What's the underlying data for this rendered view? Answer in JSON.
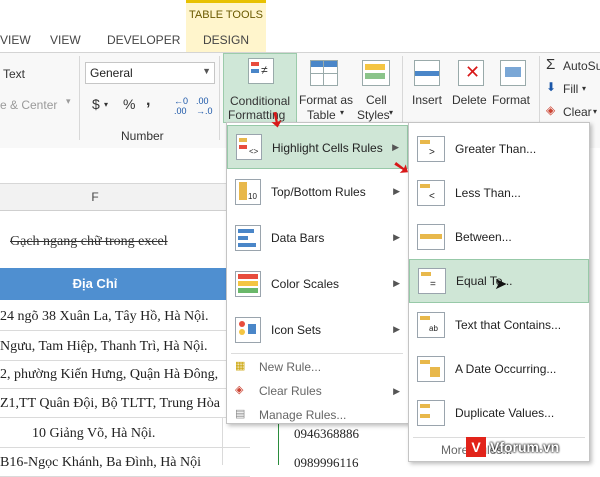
{
  "tabs": [
    "VIEW",
    "VIEW",
    "DEVELOPER"
  ],
  "table_tools": {
    "label": "TABLE TOOLS",
    "design": "DESIGN"
  },
  "ribbon": {
    "alignment": {
      "wrap_text": "Text",
      "merge_center": "e & Center"
    },
    "number": {
      "format_value": "General",
      "currency": "$",
      "percent": "%",
      "comma": ",",
      "group_label": "Number"
    },
    "styles": {
      "conditional_formatting": [
        "Conditional",
        "Formatting"
      ],
      "format_as_table": [
        "Format as",
        "Table"
      ],
      "cell_styles": [
        "Cell",
        "Styles"
      ]
    },
    "cells": {
      "insert": "Insert",
      "delete": "Delete",
      "format": "Format"
    },
    "editing": {
      "autosum": "AutoSu",
      "fill": "Fill",
      "clear": "Clear"
    }
  },
  "sheet": {
    "column_label": "F",
    "strike_text": "Gạch ngang chữ trong excel",
    "header": "Địa Chỉ",
    "rows": [
      "24 ngõ 38 Xuân La, Tây Hồ, Hà Nội.",
      "Ngưu, Tam Hiệp, Thanh Trì, Hà Nội.",
      "2, phường Kiến Hưng, Quận Hà Đông,",
      "Z1,TT Quân Đội, Bộ TLTT, Trung Hòa",
      "10 Giảng Võ, Hà Nội.",
      "B16-Ngọc Khánh, Ba Đình, Hà Nội"
    ],
    "phones": [
      "0946368886",
      "0989996116"
    ]
  },
  "menu_main": [
    {
      "label": "Highlight Cells Rules",
      "icon": "highlight-cells-icon",
      "submenu": true,
      "active": true
    },
    {
      "label": "Top/Bottom Rules",
      "icon": "top-bottom-icon",
      "submenu": true
    },
    {
      "label": "Data Bars",
      "icon": "data-bars-icon",
      "submenu": true
    },
    {
      "label": "Color Scales",
      "icon": "color-scales-icon",
      "submenu": true
    },
    {
      "label": "Icon Sets",
      "icon": "icon-sets-icon",
      "submenu": true
    }
  ],
  "menu_main_small": [
    "New Rule...",
    "Clear Rules",
    "Manage Rules..."
  ],
  "menu_sub": [
    {
      "label": "Greater Than...",
      "icon": "greater-than-icon"
    },
    {
      "label": "Less Than...",
      "icon": "less-than-icon"
    },
    {
      "label": "Between...",
      "icon": "between-icon"
    },
    {
      "label": "Equal To...",
      "icon": "equal-to-icon",
      "active": true
    },
    {
      "label": "Text that Contains...",
      "icon": "text-contains-icon"
    },
    {
      "label": "A Date Occurring...",
      "icon": "date-occurring-icon"
    },
    {
      "label": "Duplicate Values...",
      "icon": "duplicate-values-icon"
    }
  ],
  "menu_sub_more": "More Rules...",
  "watermark": "Vforum.vn",
  "colors": {
    "accent_green": "#cfe6d6",
    "header_blue": "#4f8fd0",
    "arrow_red": "#d81818"
  }
}
